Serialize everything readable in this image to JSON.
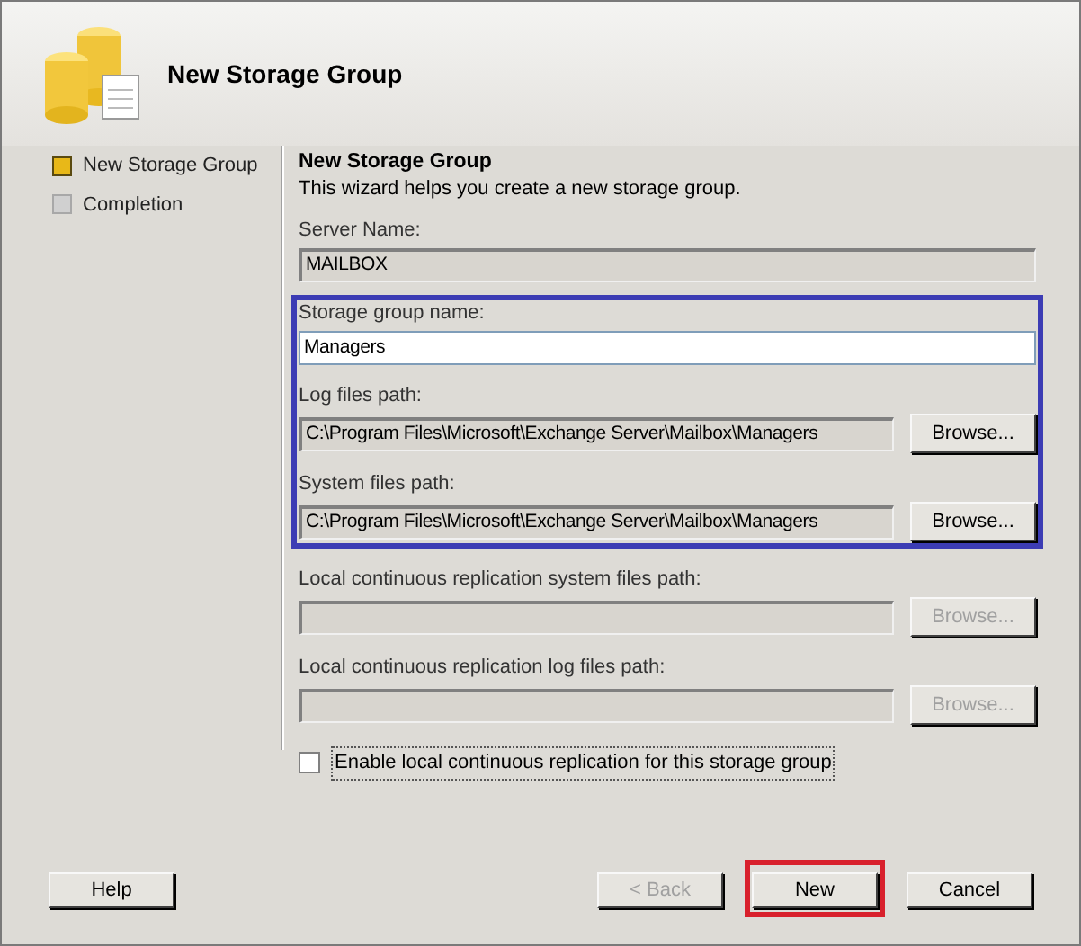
{
  "header": {
    "title": "New Storage Group"
  },
  "steps": [
    {
      "label": "New Storage Group",
      "selected": true
    },
    {
      "label": "Completion",
      "selected": false
    }
  ],
  "page": {
    "title": "New Storage Group",
    "description": "This wizard helps you create a new storage group."
  },
  "sections": [
    {
      "highlighted": false,
      "fields": [
        {
          "label": "Server Name:",
          "value": "MAILBOX",
          "editable": false
        }
      ]
    },
    {
      "highlighted": true,
      "fields": [
        {
          "label": "Storage group name:",
          "value": "Managers",
          "editable": true
        },
        {
          "label": "Log files path:",
          "value": "C:\\Program Files\\Microsoft\\Exchange Server\\Mailbox\\Managers",
          "editable": false,
          "browse": {
            "label": "Browse...",
            "disabled": false
          }
        },
        {
          "label": "System files path:",
          "value": "C:\\Program Files\\Microsoft\\Exchange Server\\Mailbox\\Managers",
          "editable": false,
          "browse": {
            "label": "Browse...",
            "disabled": false
          }
        }
      ]
    },
    {
      "highlighted": false,
      "fields": [
        {
          "label": "Local continuous replication system files path:",
          "editable": false,
          "browse": {
            "label": "Browse...",
            "disabled": true
          }
        },
        {
          "label": "Local continuous replication log files path:",
          "editable": false,
          "browse": {
            "label": "Browse...",
            "disabled": true
          }
        }
      ]
    }
  ],
  "checkbox": {
    "label": "Enable local continuous replication for this storage group",
    "checked": false
  },
  "buttons": [
    {
      "label": "Help",
      "disabled": false,
      "highlighted": false
    },
    {
      "label": "< Back",
      "disabled": true,
      "highlighted": false
    },
    {
      "label": "New",
      "disabled": false,
      "highlighted": true
    },
    {
      "label": "Cancel",
      "disabled": false,
      "highlighted": false
    }
  ]
}
